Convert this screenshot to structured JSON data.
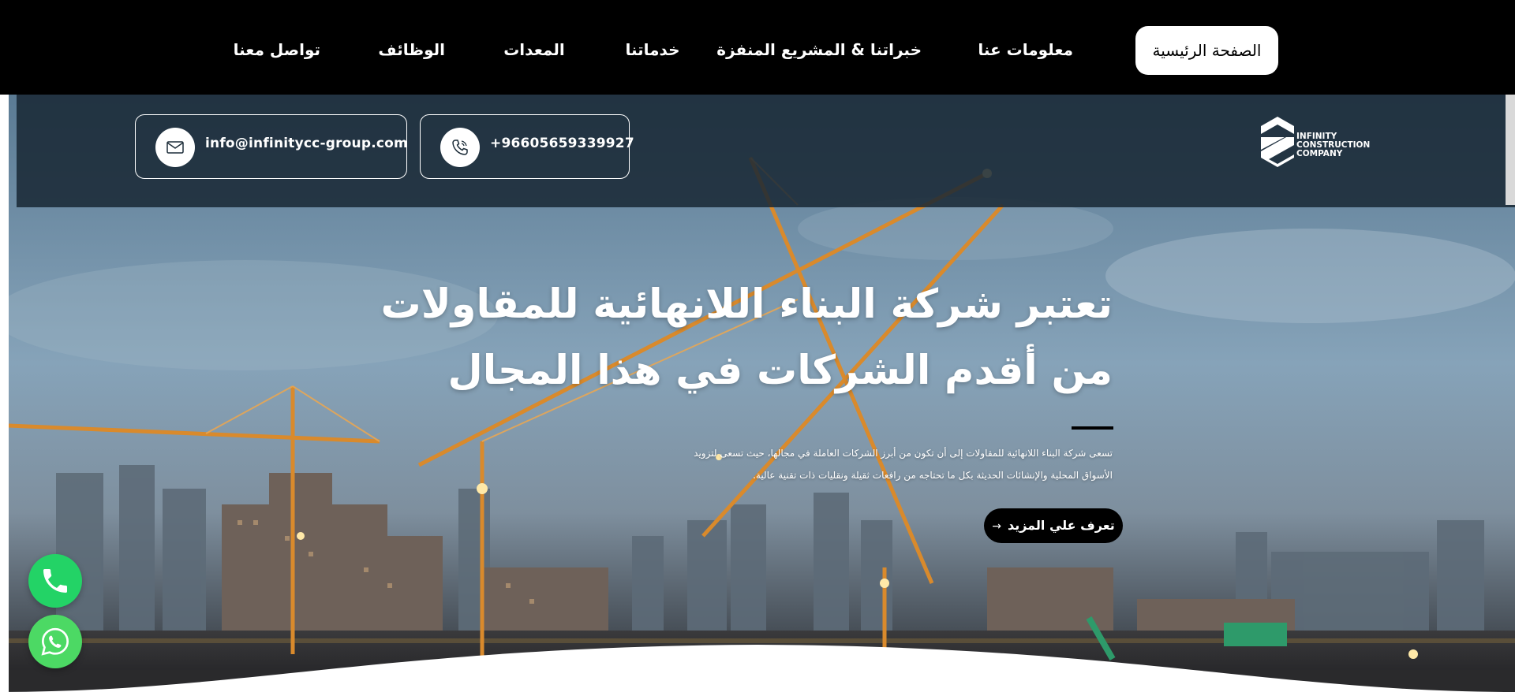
{
  "nav": {
    "items": [
      {
        "label": "الصفحة الرئيسية",
        "active": true
      },
      {
        "label": "معلومات عنا",
        "active": false
      },
      {
        "label": "خبراتنا & المشريع المنفزة",
        "active": false
      },
      {
        "label": "خدماتنا",
        "active": false
      },
      {
        "label": "المعدات",
        "active": false
      },
      {
        "label": "الوظائف",
        "active": false
      },
      {
        "label": "تواصل معنا",
        "active": false
      }
    ]
  },
  "contact": {
    "email": "info@infinitycc-group.com",
    "email_icon": "envelope-icon",
    "phone": "+96605659339927",
    "phone_icon": "phone-icon"
  },
  "logo": {
    "line1": "INFINITY",
    "line2": "CONSTRUCTION",
    "line3": "COMPANY"
  },
  "hero": {
    "headline_line1": "تعتبر شركة البناء اللانهائية للمقاولات",
    "headline_line2": "من أقدم الشركات في هذا المجال",
    "description_line1": "تسعى  شركة البناء اللانهائية للمقاولات إلى أن تكون من أبرز الشركات العاملة في مجالها، حيث تسعى لتزويد",
    "description_line2": "الأسواق المحلية والإنشائات الحديثة بكل ما تحتاجه من رافعات ثقيلة ونقليات ذات تقنية عالية.",
    "cta_label": "تعرف علي المزيد",
    "cta_icon": "arrow-icon"
  },
  "floating": {
    "call_icon": "phone-icon",
    "whatsapp_icon": "whatsapp-icon"
  },
  "colors": {
    "nav_bg": "#000000",
    "call_green": "#23d366",
    "whatsapp_green": "#4cd964"
  }
}
